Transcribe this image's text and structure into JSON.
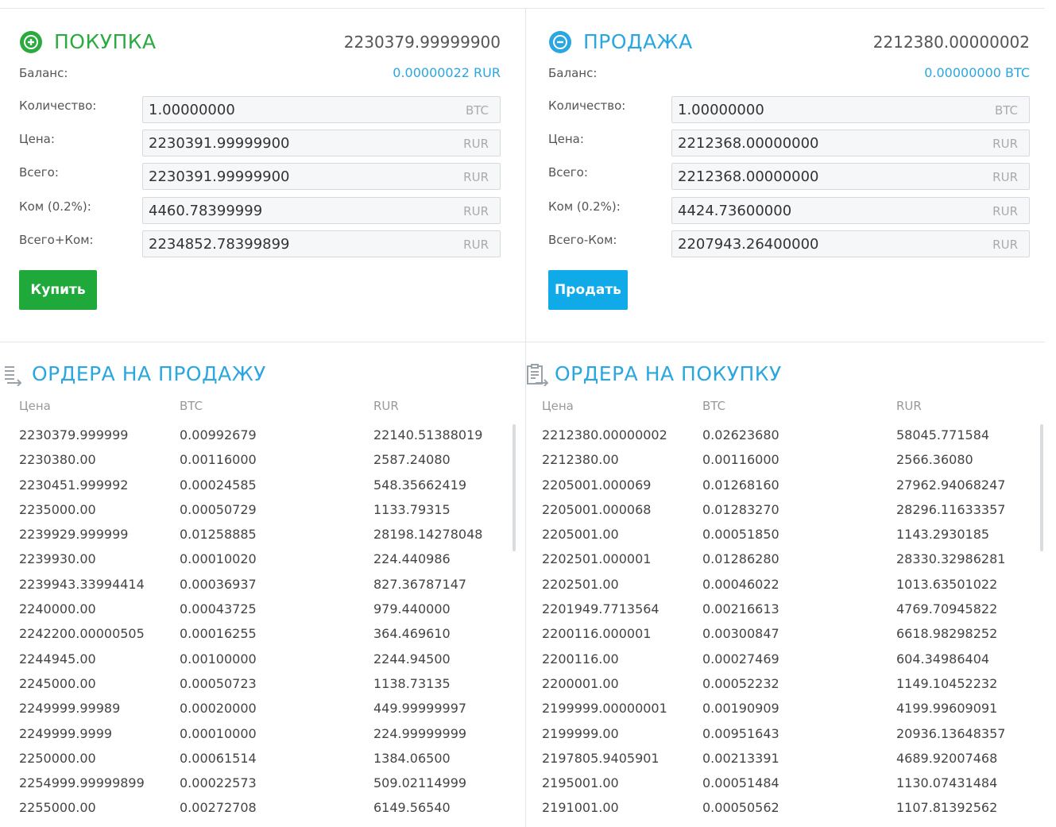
{
  "buy": {
    "title": "ПОКУПКА",
    "best_price": "2230379.99999900",
    "balance_label": "Баланс:",
    "balance_value": "0.00000022 RUR",
    "fields": [
      {
        "label": "Количество:",
        "value": "1.00000000",
        "unit": "BTC"
      },
      {
        "label": "Цена:",
        "value": "2230391.99999900",
        "unit": "RUR"
      },
      {
        "label": "Всего:",
        "value": "2230391.99999900",
        "unit": "RUR"
      },
      {
        "label": "Ком (0.2%):",
        "value": "4460.78399999",
        "unit": "RUR"
      },
      {
        "label": "Всего+Ком:",
        "value": "2234852.78399899",
        "unit": "RUR"
      }
    ],
    "button": "Купить",
    "color": "#2bab3f"
  },
  "sell": {
    "title": "ПРОДАЖА",
    "best_price": "2212380.00000002",
    "balance_label": "Баланс:",
    "balance_value": "0.00000000 BTC",
    "fields": [
      {
        "label": "Количество:",
        "value": "1.00000000",
        "unit": "BTC"
      },
      {
        "label": "Цена:",
        "value": "2212368.00000000",
        "unit": "RUR"
      },
      {
        "label": "Всего:",
        "value": "2212368.00000000",
        "unit": "RUR"
      },
      {
        "label": "Ком (0.2%):",
        "value": "4424.73600000",
        "unit": "RUR"
      },
      {
        "label": "Всего-Ком:",
        "value": "2207943.26400000",
        "unit": "RUR"
      }
    ],
    "button": "Продать",
    "color": "#2aa7e0"
  },
  "sell_orders": {
    "title": "ОРДЕРА НА ПРОДАЖУ",
    "columns": [
      "Цена",
      "BTC",
      "RUR"
    ],
    "rows": [
      [
        "2230379.999999",
        "0.00992679",
        "22140.51388019"
      ],
      [
        "2230380.00",
        "0.00116000",
        "2587.24080"
      ],
      [
        "2230451.999992",
        "0.00024585",
        "548.35662419"
      ],
      [
        "2235000.00",
        "0.00050729",
        "1133.79315"
      ],
      [
        "2239929.999999",
        "0.01258885",
        "28198.14278048"
      ],
      [
        "2239930.00",
        "0.00010020",
        "224.440986"
      ],
      [
        "2239943.33994414",
        "0.00036937",
        "827.36787147"
      ],
      [
        "2240000.00",
        "0.00043725",
        "979.440000"
      ],
      [
        "2242200.00000505",
        "0.00016255",
        "364.469610"
      ],
      [
        "2244945.00",
        "0.00100000",
        "2244.94500"
      ],
      [
        "2245000.00",
        "0.00050723",
        "1138.73135"
      ],
      [
        "2249999.99989",
        "0.00020000",
        "449.99999997"
      ],
      [
        "2249999.9999",
        "0.00010000",
        "224.99999999"
      ],
      [
        "2250000.00",
        "0.00061514",
        "1384.06500"
      ],
      [
        "2254999.99999899",
        "0.00022573",
        "509.02114999"
      ],
      [
        "2255000.00",
        "0.00272708",
        "6149.56540"
      ]
    ]
  },
  "buy_orders": {
    "title": "ОРДЕРА НА ПОКУПКУ",
    "columns": [
      "Цена",
      "BTC",
      "RUR"
    ],
    "rows": [
      [
        "2212380.00000002",
        "0.02623680",
        "58045.771584"
      ],
      [
        "2212380.00",
        "0.00116000",
        "2566.36080"
      ],
      [
        "2205001.000069",
        "0.01268160",
        "27962.94068247"
      ],
      [
        "2205001.000068",
        "0.01283270",
        "28296.11633357"
      ],
      [
        "2205001.00",
        "0.00051850",
        "1143.2930185"
      ],
      [
        "2202501.000001",
        "0.01286280",
        "28330.32986281"
      ],
      [
        "2202501.00",
        "0.00046022",
        "1013.63501022"
      ],
      [
        "2201949.7713564",
        "0.00216613",
        "4769.70945822"
      ],
      [
        "2200116.000001",
        "0.00300847",
        "6618.98298252"
      ],
      [
        "2200116.00",
        "0.00027469",
        "604.34986404"
      ],
      [
        "2200001.00",
        "0.00052232",
        "1149.10452232"
      ],
      [
        "2199999.00000001",
        "0.00190909",
        "4199.99609091"
      ],
      [
        "2199999.00",
        "0.00951643",
        "20936.13648357"
      ],
      [
        "2197805.9405901",
        "0.00213391",
        "4689.92007468"
      ],
      [
        "2195001.00",
        "0.00051484",
        "1130.07431484"
      ],
      [
        "2191001.00",
        "0.00050562",
        "1107.81392562"
      ]
    ]
  }
}
